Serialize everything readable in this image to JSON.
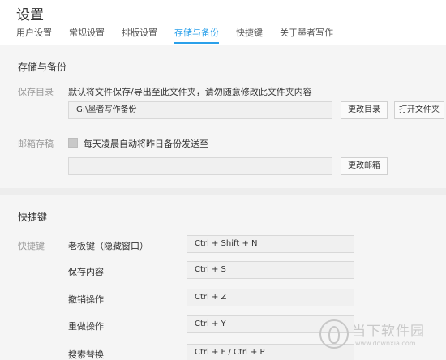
{
  "header": {
    "title": "设置",
    "tabs": [
      {
        "label": "用户设置"
      },
      {
        "label": "常规设置"
      },
      {
        "label": "排版设置"
      },
      {
        "label": "存储与备份"
      },
      {
        "label": "快捷键"
      },
      {
        "label": "关于墨者写作"
      }
    ],
    "active_tab_color": "#2aa0ea"
  },
  "storage": {
    "title": "存储与备份",
    "save_dir_label": "保存目录",
    "save_dir_desc": "默认将文件保存/导出至此文件夹，请勿随意修改此文件夹内容",
    "save_dir_value": "G:\\墨者写作备份",
    "change_dir_btn": "更改目录",
    "open_folder_btn": "打开文件夹",
    "mail_label": "邮箱存稿",
    "mail_checkbox_text": "每天凌晨自动将昨日备份发送至",
    "mail_value": "",
    "change_mail_btn": "更改邮箱"
  },
  "shortcuts": {
    "title": "快捷键",
    "label": "快捷键",
    "items": [
      {
        "name": "老板键（隐藏窗口）",
        "keys": "Ctrl + Shift + N"
      },
      {
        "name": "保存内容",
        "keys": "Ctrl + S"
      },
      {
        "name": "撤销操作",
        "keys": "Ctrl + Z"
      },
      {
        "name": "重做操作",
        "keys": "Ctrl + Y"
      },
      {
        "name": "搜索替换",
        "keys": "Ctrl + F / Ctrl + P"
      }
    ]
  },
  "watermark": {
    "text": "当下软件园",
    "url": "www.downxia.com"
  }
}
